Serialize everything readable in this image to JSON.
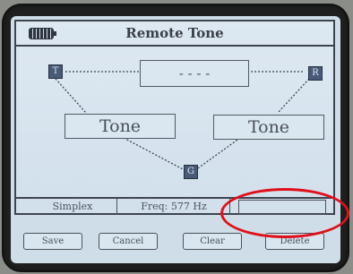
{
  "title": "Remote Tone",
  "center_value": "- - - -",
  "nodes": {
    "left": "T",
    "right": "R",
    "bottom": "G"
  },
  "tones": {
    "left": "Tone",
    "right": "Tone"
  },
  "status": {
    "mode": "Simplex",
    "freq": "Freq:  577 Hz",
    "extra": ""
  },
  "softkeys": [
    "Save",
    "Cancel",
    "Clear",
    "Delete"
  ],
  "colors": {
    "screen": "#cfdde8",
    "node": "#485a78",
    "highlight": "#e0101a"
  }
}
